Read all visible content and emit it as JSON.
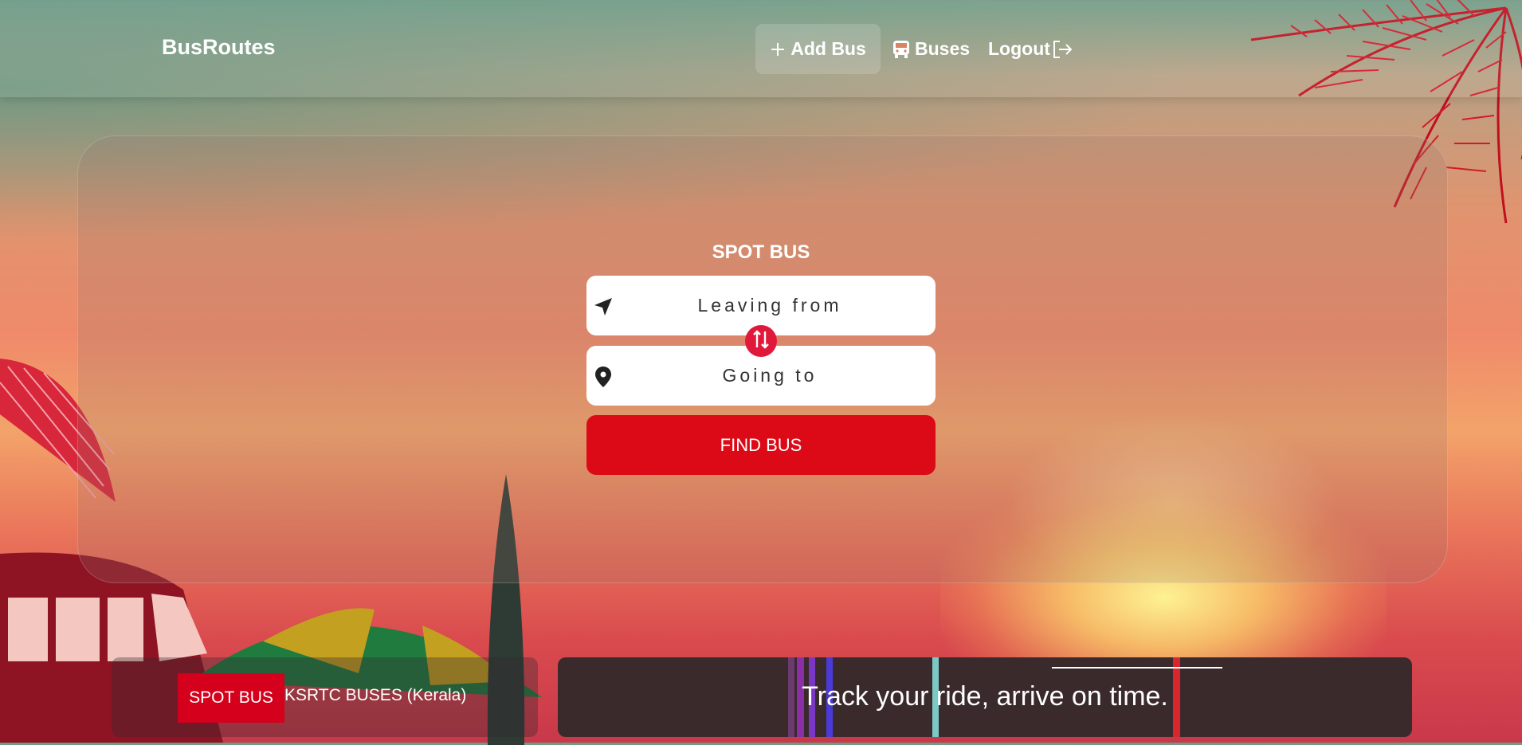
{
  "brand": "BusRoutes",
  "nav": {
    "add_bus": "Add Bus",
    "buses": "Buses",
    "logout": "Logout"
  },
  "search": {
    "title": "SPOT BUS",
    "from_placeholder": "Leaving from",
    "to_placeholder": "Going to",
    "find_label": "FIND BUS"
  },
  "footer": {
    "badge": "SPOT BUS",
    "operator": "KSRTC BUSES (Kerala)",
    "tagline": "Track your ride, arrive on time."
  },
  "colors": {
    "accent_red": "#dc0a16",
    "swap_red": "#e0193b",
    "badge_red": "#d4001c"
  }
}
